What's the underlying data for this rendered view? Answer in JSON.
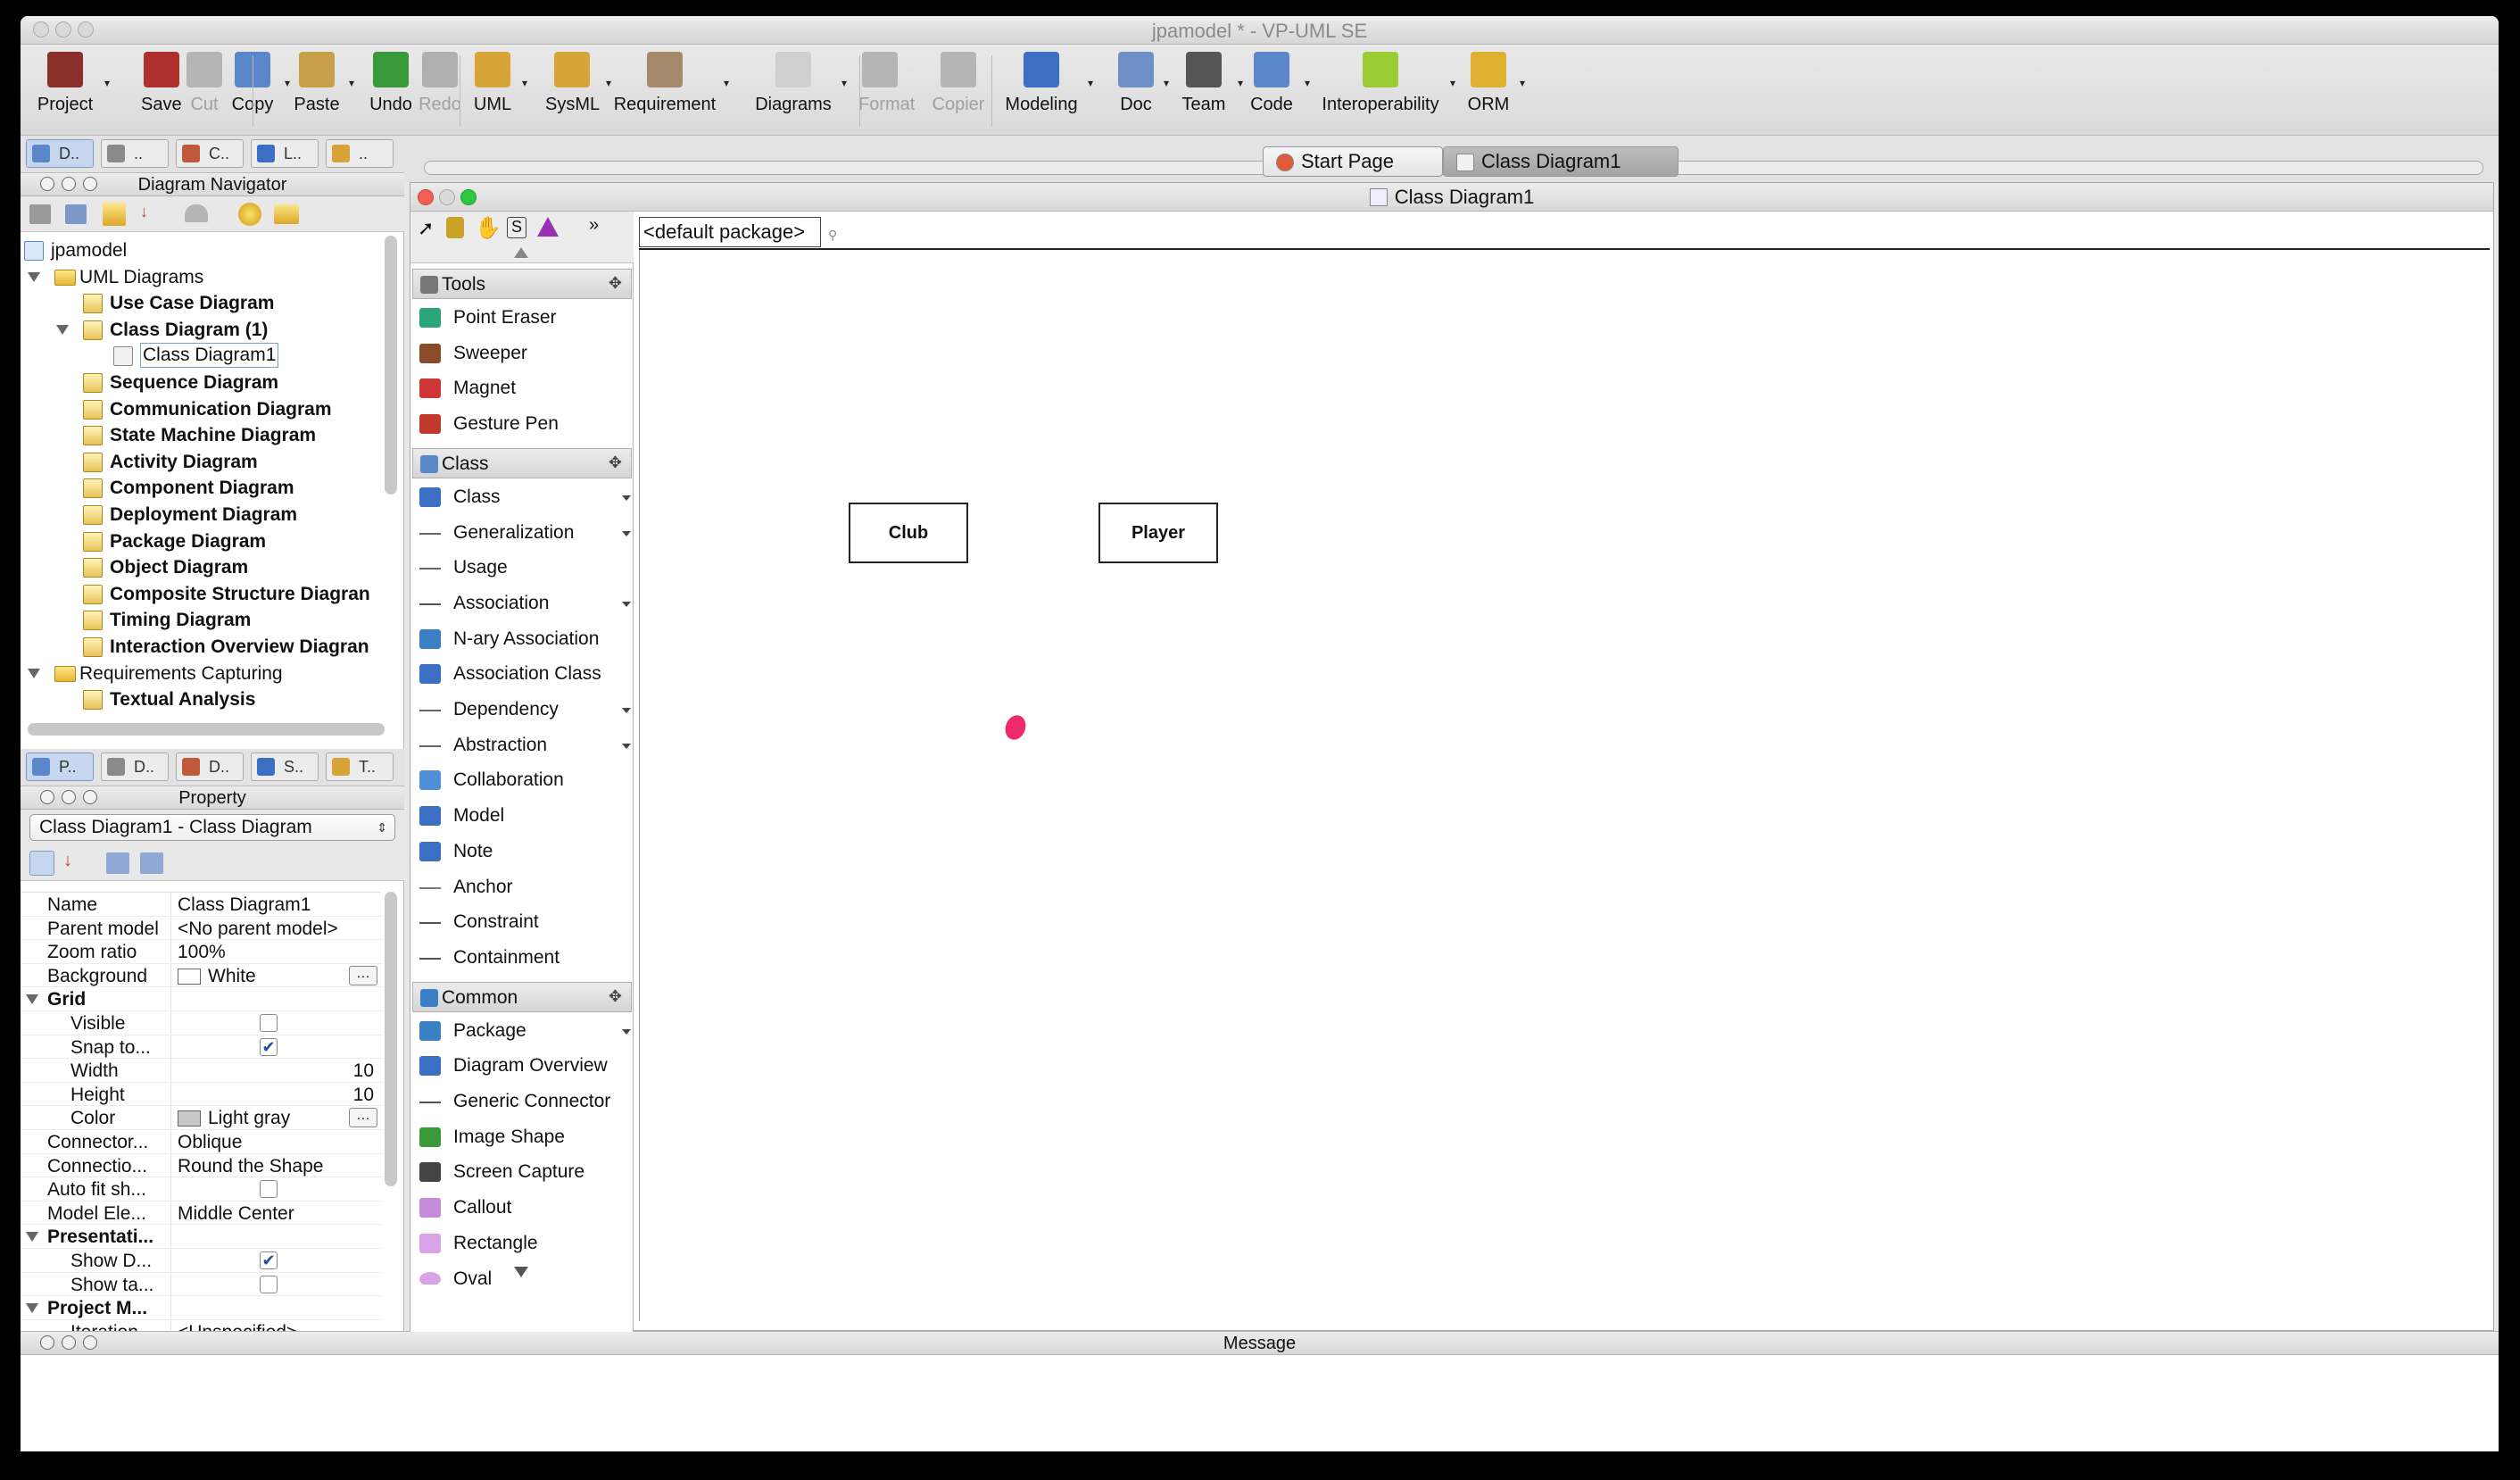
{
  "window": {
    "title": "jpamodel * - VP-UML SE"
  },
  "toolbar": {
    "items": [
      {
        "label": "Project",
        "icon": "project-book-icon",
        "enabled": true
      },
      {
        "label": "Save",
        "icon": "save-book-icon",
        "enabled": true
      },
      {
        "label": "Cut",
        "icon": "scissors-icon",
        "enabled": false
      },
      {
        "label": "Copy",
        "icon": "copy-icon",
        "enabled": true
      },
      {
        "label": "Paste",
        "icon": "clipboard-icon",
        "enabled": true
      },
      {
        "label": "Undo",
        "icon": "undo-arrow-icon",
        "enabled": true
      },
      {
        "label": "Redo",
        "icon": "redo-arrow-icon",
        "enabled": false
      },
      {
        "label": "UML",
        "icon": "uml-icon",
        "enabled": true
      },
      {
        "label": "SysML",
        "icon": "sysml-icon",
        "enabled": true
      },
      {
        "label": "Requirement",
        "icon": "requirement-icon",
        "enabled": true
      },
      {
        "label": "Diagrams",
        "icon": "diagrams-icon",
        "enabled": true
      },
      {
        "label": "Format",
        "icon": "format-f-icon",
        "enabled": false
      },
      {
        "label": "Copier",
        "icon": "copier-brush-icon",
        "enabled": false
      },
      {
        "label": "Modeling",
        "icon": "modeling-icon",
        "enabled": true
      },
      {
        "label": "Doc",
        "icon": "doc-icon",
        "enabled": true
      },
      {
        "label": "Team",
        "icon": "team-icon",
        "enabled": true
      },
      {
        "label": "Code",
        "icon": "code-icon",
        "enabled": true
      },
      {
        "label": "Interoperability",
        "icon": "interoperability-icon",
        "enabled": true
      },
      {
        "label": "ORM",
        "icon": "orm-database-icon",
        "enabled": true
      }
    ]
  },
  "navigator_tabs": [
    {
      "label": "D..",
      "selected": true
    },
    {
      "label": "..",
      "selected": false
    },
    {
      "label": "C..",
      "selected": false
    },
    {
      "label": "L..",
      "selected": false
    },
    {
      "label": "..",
      "selected": false
    }
  ],
  "diagram_navigator": {
    "title": "Diagram Navigator",
    "tree": [
      {
        "label": "jpamodel",
        "bold": false,
        "level": 0,
        "kind": "project"
      },
      {
        "label": "UML Diagrams",
        "bold": false,
        "level": 1,
        "kind": "folder",
        "expanded": true
      },
      {
        "label": "Use Case Diagram",
        "bold": true,
        "level": 2,
        "kind": "diagram"
      },
      {
        "label": "Class Diagram (1)",
        "bold": true,
        "level": 2,
        "kind": "diagram",
        "expanded": true
      },
      {
        "label": "Class Diagram1",
        "bold": false,
        "level": 3,
        "kind": "class-diagram",
        "collapsed": true,
        "selected": true
      },
      {
        "label": "Sequence Diagram",
        "bold": true,
        "level": 2,
        "kind": "diagram"
      },
      {
        "label": "Communication Diagram",
        "bold": true,
        "level": 2,
        "kind": "diagram"
      },
      {
        "label": "State Machine Diagram",
        "bold": true,
        "level": 2,
        "kind": "diagram"
      },
      {
        "label": "Activity Diagram",
        "bold": true,
        "level": 2,
        "kind": "diagram"
      },
      {
        "label": "Component Diagram",
        "bold": true,
        "level": 2,
        "kind": "diagram"
      },
      {
        "label": "Deployment Diagram",
        "bold": true,
        "level": 2,
        "kind": "diagram"
      },
      {
        "label": "Package Diagram",
        "bold": true,
        "level": 2,
        "kind": "diagram"
      },
      {
        "label": "Object Diagram",
        "bold": true,
        "level": 2,
        "kind": "diagram"
      },
      {
        "label": "Composite Structure Diagran",
        "bold": true,
        "level": 2,
        "kind": "diagram"
      },
      {
        "label": "Timing Diagram",
        "bold": true,
        "level": 2,
        "kind": "diagram"
      },
      {
        "label": "Interaction Overview Diagran",
        "bold": true,
        "level": 2,
        "kind": "diagram"
      },
      {
        "label": "Requirements Capturing",
        "bold": false,
        "level": 1,
        "kind": "folder",
        "expanded": true
      },
      {
        "label": "Textual Analysis",
        "bold": true,
        "level": 2,
        "kind": "diagram"
      }
    ]
  },
  "property_tabs": [
    {
      "label": "P..",
      "selected": true
    },
    {
      "label": "D..",
      "selected": false
    },
    {
      "label": "D..",
      "selected": false
    },
    {
      "label": "S..",
      "selected": false
    },
    {
      "label": "T..",
      "selected": false
    }
  ],
  "property": {
    "title": "Property",
    "selector_value": "Class Diagram1 - Class Diagram",
    "rows": [
      {
        "key": "Name",
        "value": "Class Diagram1",
        "type": "text",
        "indent": 0
      },
      {
        "key": "Parent model",
        "value": "<No parent model>",
        "type": "text",
        "indent": 0
      },
      {
        "key": "Zoom ratio",
        "value": "100%",
        "type": "text",
        "indent": 0
      },
      {
        "key": "Background",
        "value": "White",
        "type": "color",
        "swatch": "#ffffff",
        "indent": 0
      },
      {
        "key": "Grid",
        "value": "",
        "type": "group",
        "indent": 0
      },
      {
        "key": "Visible",
        "value": "",
        "type": "check",
        "checked": false,
        "indent": 1
      },
      {
        "key": "Snap to...",
        "value": "",
        "type": "check",
        "checked": true,
        "indent": 1
      },
      {
        "key": "Width",
        "value": "10",
        "type": "number",
        "indent": 1
      },
      {
        "key": "Height",
        "value": "10",
        "type": "number",
        "indent": 1
      },
      {
        "key": "Color",
        "value": "Light gray",
        "type": "color",
        "swatch": "#c8c8c8",
        "indent": 1
      },
      {
        "key": "Connector...",
        "value": "Oblique",
        "type": "text",
        "indent": 0
      },
      {
        "key": "Connectio...",
        "value": "Round the Shape",
        "type": "text",
        "indent": 0
      },
      {
        "key": "Auto fit sh...",
        "value": "",
        "type": "check",
        "checked": false,
        "indent": 0
      },
      {
        "key": "Model Ele...",
        "value": "Middle Center",
        "type": "text",
        "indent": 0
      },
      {
        "key": "Presentati...",
        "value": "",
        "type": "group",
        "indent": 0
      },
      {
        "key": "Show D...",
        "value": "",
        "type": "check",
        "checked": true,
        "indent": 1
      },
      {
        "key": "Show ta...",
        "value": "",
        "type": "check",
        "checked": false,
        "indent": 1
      },
      {
        "key": "Project M...",
        "value": "",
        "type": "group",
        "indent": 0
      },
      {
        "key": "Iteration",
        "value": "<Unspecified>",
        "type": "text",
        "indent": 1
      }
    ]
  },
  "editor_tabs": [
    {
      "label": "Start Page",
      "selected": false
    },
    {
      "label": "Class Diagram1",
      "selected": true
    }
  ],
  "diagram_window": {
    "title": "Class Diagram1",
    "package_label": "<default package>"
  },
  "palette": {
    "sections": [
      {
        "title": "Tools",
        "items": [
          {
            "label": "Point Eraser",
            "icon": "eraser-icon",
            "color": "#2aa57a",
            "more": false
          },
          {
            "label": "Sweeper",
            "icon": "sweeper-icon",
            "color": "#8a4b2a",
            "more": false
          },
          {
            "label": "Magnet",
            "icon": "magnet-icon",
            "color": "#d03535",
            "more": false
          },
          {
            "label": "Gesture Pen",
            "icon": "pen-icon",
            "color": "#c0392b",
            "more": false
          }
        ]
      },
      {
        "title": "Class",
        "items": [
          {
            "label": "Class",
            "icon": "class-icon",
            "color": "#3b6fc4",
            "more": true
          },
          {
            "label": "Generalization",
            "icon": "generalization-icon",
            "color": "#666666",
            "more": true
          },
          {
            "label": "Usage",
            "icon": "usage-icon",
            "color": "#666666",
            "more": false
          },
          {
            "label": "Association",
            "icon": "association-icon",
            "color": "#555555",
            "more": true
          },
          {
            "label": "N-ary Association",
            "icon": "nary-association-icon",
            "color": "#3b7fc4",
            "more": false
          },
          {
            "label": "Association Class",
            "icon": "association-class-icon",
            "color": "#3b6fc4",
            "more": false
          },
          {
            "label": "Dependency",
            "icon": "dependency-icon",
            "color": "#666666",
            "more": true
          },
          {
            "label": "Abstraction",
            "icon": "abstraction-icon",
            "color": "#666666",
            "more": true
          },
          {
            "label": "Collaboration",
            "icon": "collaboration-icon",
            "color": "#4f8fd8",
            "more": false
          },
          {
            "label": "Model",
            "icon": "model-icon",
            "color": "#3b6fc4",
            "more": false
          },
          {
            "label": "Note",
            "icon": "note-icon",
            "color": "#3b6fc4",
            "more": false
          },
          {
            "label": "Anchor",
            "icon": "anchor-icon",
            "color": "#777777",
            "more": false
          },
          {
            "label": "Constraint",
            "icon": "constraint-icon",
            "color": "#555555",
            "more": false
          },
          {
            "label": "Containment",
            "icon": "containment-icon",
            "color": "#555555",
            "more": false
          }
        ]
      },
      {
        "title": "Common",
        "items": [
          {
            "label": "Package",
            "icon": "package-icon",
            "color": "#3b7fc4",
            "more": true
          },
          {
            "label": "Diagram Overview",
            "icon": "diagram-overview-icon",
            "color": "#3b6fc4",
            "more": false
          },
          {
            "label": "Generic Connector",
            "icon": "generic-connector-icon",
            "color": "#555555",
            "more": false
          },
          {
            "label": "Image Shape",
            "icon": "image-shape-icon",
            "color": "#3a9a3a",
            "more": false
          },
          {
            "label": "Screen Capture",
            "icon": "camera-icon",
            "color": "#444444",
            "more": false
          },
          {
            "label": "Callout",
            "icon": "callout-icon",
            "color": "#c58ad8",
            "more": false
          },
          {
            "label": "Rectangle",
            "icon": "rectangle-icon",
            "color": "#d9a3e8",
            "more": false
          },
          {
            "label": "Oval",
            "icon": "oval-icon",
            "color": "#d9a3e8",
            "more": false
          }
        ]
      }
    ]
  },
  "canvas": {
    "classes": [
      {
        "name": "Club"
      },
      {
        "name": "Player"
      }
    ]
  },
  "message_panel": {
    "title": "Message"
  },
  "colors": {
    "accent": "#7f9bc9",
    "cursor_dot": "#ee2a6a"
  }
}
